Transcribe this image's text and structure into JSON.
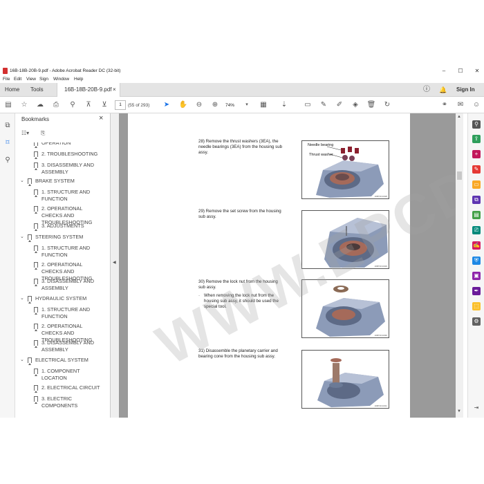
{
  "window": {
    "title": "16B-18B-20B-9.pdf - Adobe Acrobat Reader DC (32-bit)",
    "minimize": "–",
    "maximize": "☐",
    "close": "✕"
  },
  "menu": [
    "File",
    "Edit",
    "View",
    "Sign",
    "Window",
    "Help"
  ],
  "tabs": {
    "home": "Home",
    "tools": "Tools",
    "document": "16B-18B-20B-9.pdf",
    "document_close": "×",
    "sign_in": "Sign In"
  },
  "toolbar": {
    "page_number": "1",
    "page_count": "(55 of 293)",
    "zoom": "74%"
  },
  "bookmarks": {
    "title": "Bookmarks",
    "close": "×",
    "items": [
      {
        "label": "OPERATION",
        "level": 2,
        "section": false
      },
      {
        "label": "2. TROUBLESHOOTING",
        "level": 2,
        "section": false
      },
      {
        "label": "3. DISASSEMBLY AND ASSEMBLY",
        "level": 2,
        "section": false
      },
      {
        "label": "BRAKE SYSTEM",
        "level": 1,
        "section": true
      },
      {
        "label": "1. STRUCTURE AND FUNCTION",
        "level": 2,
        "section": false
      },
      {
        "label": "2. OPERATIONAL CHECKS AND TROUBLESHOOTING",
        "level": 2,
        "section": false
      },
      {
        "label": "3. ADJUSTMENTS",
        "level": 2,
        "section": false
      },
      {
        "label": "STEERING SYSTEM",
        "level": 1,
        "section": true
      },
      {
        "label": "1. STRUCTURE AND FUNCTION",
        "level": 2,
        "section": false
      },
      {
        "label": "2. OPERATIONAL CHECKS AND TROUBLESHOOTING",
        "level": 2,
        "section": false
      },
      {
        "label": "3. DISASSEMBLY AND ASSEMBLY",
        "level": 2,
        "section": false
      },
      {
        "label": "HYDRAULIC SYSTEM",
        "level": 1,
        "section": true
      },
      {
        "label": "1. STRUCTURE AND FUNCTION",
        "level": 2,
        "section": false
      },
      {
        "label": "2. OPERATIONAL CHECKS AND TROUBLESHOOTING",
        "level": 2,
        "section": false
      },
      {
        "label": "3. DISASSEMBLY AND ASSEMBLY",
        "level": 2,
        "section": false
      },
      {
        "label": "ELECTRICAL SYSTEM",
        "level": 1,
        "section": true
      },
      {
        "label": "1. COMPONENT LOCATION",
        "level": 2,
        "section": false
      },
      {
        "label": "2. ELECTRICAL CIRCUIT",
        "level": 2,
        "section": false
      },
      {
        "label": "3. ELECTRIC COMPONENTS",
        "level": 2,
        "section": false
      }
    ]
  },
  "document": {
    "steps": [
      {
        "text": "28) Remove the thrust washers (3EA), the needle bearings (3EA) from the housing sub assy.",
        "note": "",
        "figure": {
          "labels": [
            "Needle bearing",
            "Thrust washer"
          ],
          "caption": "16BT3OU028"
        }
      },
      {
        "text": "29) Remove the set screw from the housing sub assy.",
        "note": "",
        "figure": {
          "labels": [],
          "caption": "16BT3OU029"
        }
      },
      {
        "text": "30) Remove the lock nut from the housing sub assy.",
        "note": "When removing the lock nut from the housing sub assy, it should be used the special tool.",
        "figure": {
          "labels": [],
          "caption": "16BT3OU030"
        }
      },
      {
        "text": "31) Disassemble the planetary carrier and bearing cone from the housing sub assy.",
        "note": "",
        "figure": {
          "labels": [],
          "caption": "16BT3OU031"
        }
      }
    ],
    "watermark": "WWW.EPCDEPO.COM"
  },
  "colors": {
    "doc_background": "#9a9a9a",
    "accent_blue": "#1a73e8",
    "pdf_red": "#d32f2f"
  }
}
